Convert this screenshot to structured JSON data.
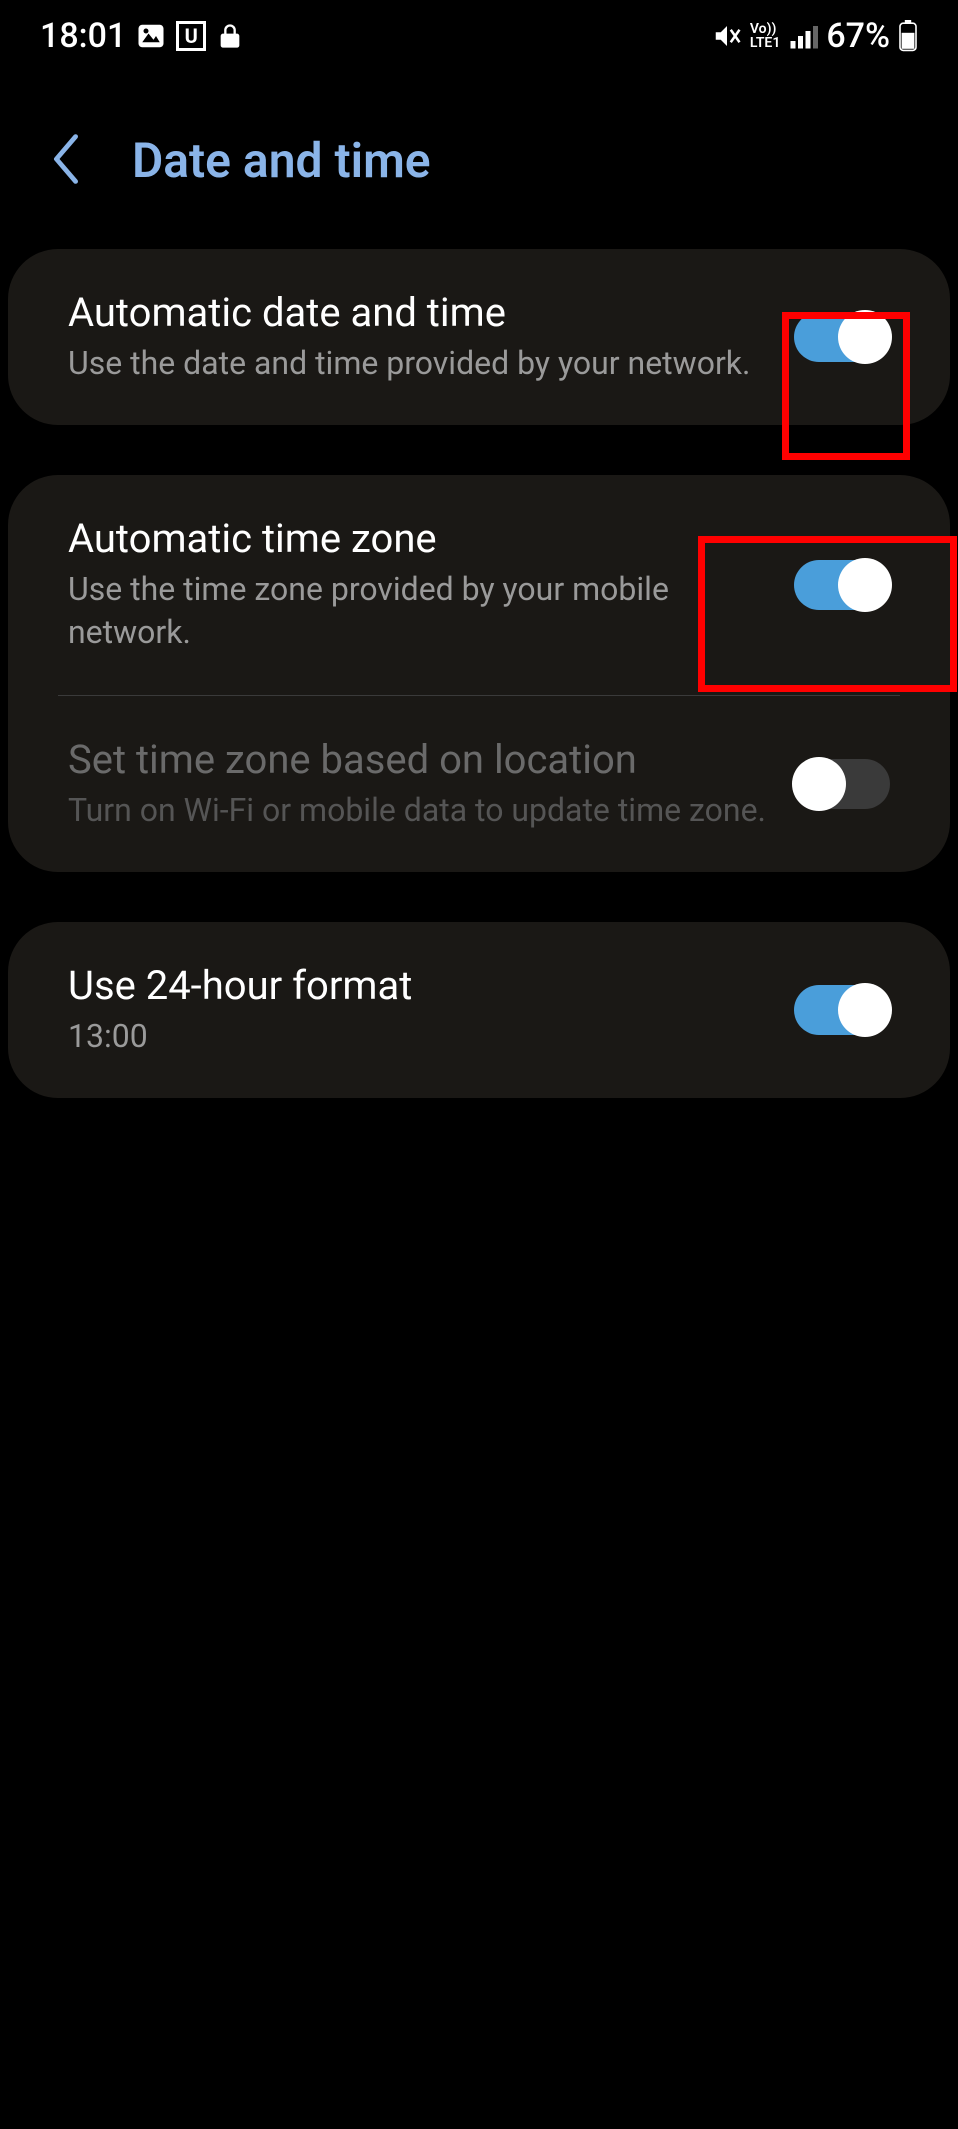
{
  "status_bar": {
    "time": "18:01",
    "battery_pct": "67%",
    "lte_top": "Vo))",
    "lte_bottom": "LTE1",
    "u_icon_letter": "U"
  },
  "header": {
    "title": "Date and time"
  },
  "rows": {
    "auto_date": {
      "title": "Automatic date and time",
      "sub": "Use the date and time provided by your network."
    },
    "auto_tz": {
      "title": "Automatic time zone",
      "sub": "Use the time zone provided by your mobile network."
    },
    "tz_location": {
      "title": "Set time zone based on location",
      "sub": "Turn on Wi-Fi or mobile data to update time zone."
    },
    "format24": {
      "title": "Use 24-hour format",
      "sub": "13:00"
    }
  }
}
